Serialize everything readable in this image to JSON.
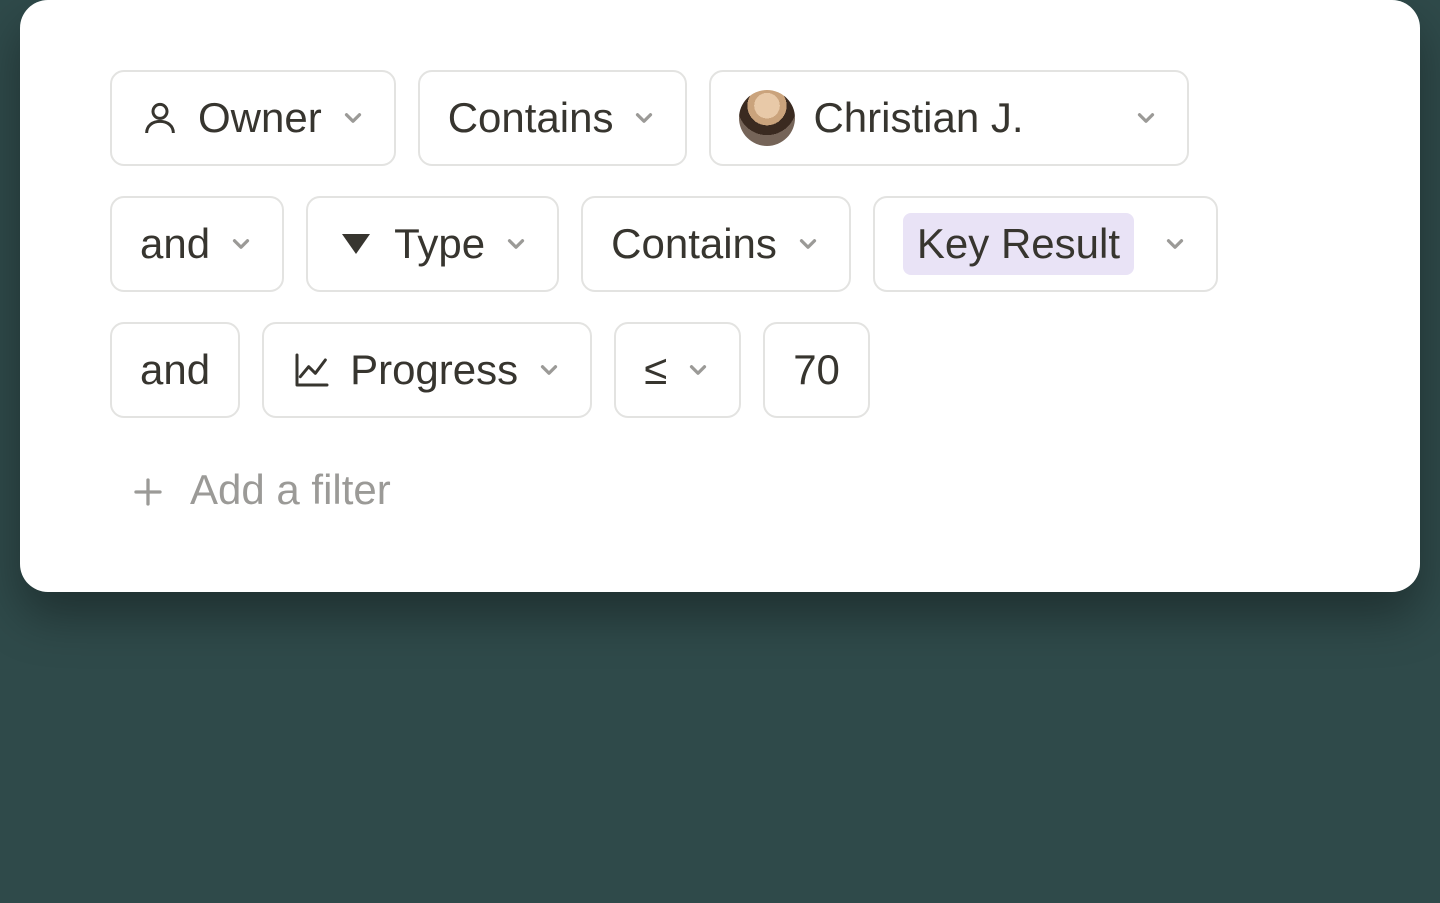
{
  "filters": {
    "row1": {
      "property": {
        "icon": "person",
        "label": "Owner"
      },
      "operator": {
        "label": "Contains"
      },
      "value": {
        "type": "person",
        "label": "Christian J."
      }
    },
    "row2": {
      "conjunction": {
        "label": "and"
      },
      "property": {
        "icon": "triangle",
        "label": "Type"
      },
      "operator": {
        "label": "Contains"
      },
      "value": {
        "type": "tag",
        "label": "Key Result",
        "tag_color": "#e9e3f6"
      }
    },
    "row3": {
      "conjunction": {
        "label": "and"
      },
      "property": {
        "icon": "chart",
        "label": "Progress"
      },
      "operator": {
        "label": "≤"
      },
      "value": {
        "type": "number",
        "label": "70"
      }
    }
  },
  "add_filter_label": "Add a filter",
  "colors": {
    "border": "#e3e3e1",
    "text": "#37352f",
    "muted": "#9b9a97",
    "tag_bg": "#e9e3f6"
  }
}
